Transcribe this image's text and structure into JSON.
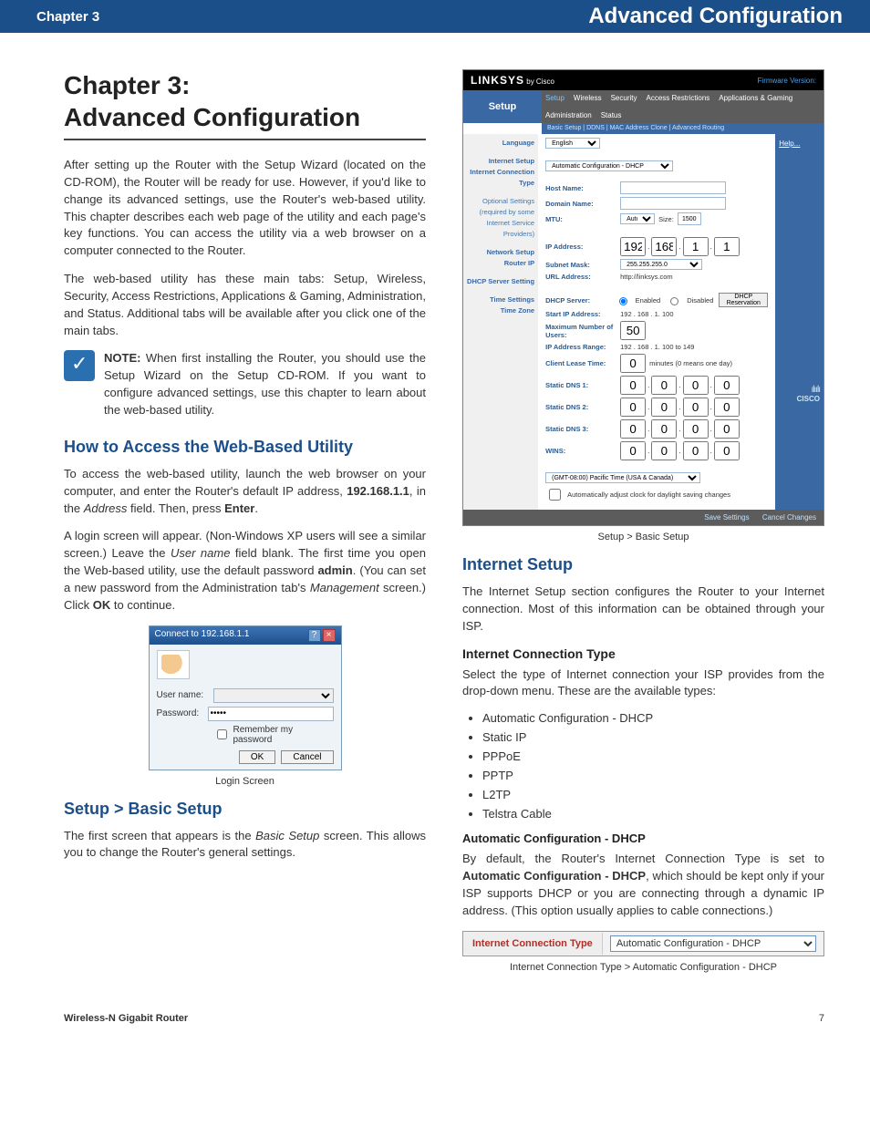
{
  "header": {
    "chapter": "Chapter 3",
    "section": "Advanced Configuration"
  },
  "page": {
    "title_line1": "Chapter 3:",
    "title_line2": "Advanced Configuration",
    "intro_p1": "After setting up the Router with the Setup Wizard (located on the CD-ROM), the Router will be ready for use. However, if you'd like to change its advanced settings, use the Router's web-based utility. This chapter describes each web page of the utility and each page's key functions. You can access the utility via a web browser on a computer connected to the Router.",
    "intro_p2": "The web-based utility has these main tabs: Setup, Wireless, Security, Access Restrictions, Applications & Gaming, Administration, and Status. Additional tabs will be available after you click one of the main tabs.",
    "note_label": "NOTE:",
    "note_text": " When first installing the Router, you should use the Setup Wizard on the Setup CD-ROM. If you want to configure advanced settings, use this chapter to learn about the web-based utility.",
    "h2_access": "How to Access the Web-Based Utility",
    "access_p1a": "To access the web-based utility, launch the web browser on your computer, and enter the Router's default IP address, ",
    "access_ip": "192.168.1.1",
    "access_p1b": ", in the ",
    "access_addrfield": "Address",
    "access_p1c": " field. Then, press ",
    "access_enter": "Enter",
    "access_p1d": ".",
    "access_p2a": "A login screen will appear. (Non-Windows XP users will see a similar screen.) Leave the ",
    "access_username_i": "User name",
    "access_p2b": " field blank. The first time you open the Web-based utility, use the default password ",
    "access_admin": "admin",
    "access_p2c": ". (You can set a new password from the Administration tab's ",
    "access_mgmt_i": "Management",
    "access_p2d": " screen.) Click ",
    "access_ok": "OK",
    "access_p2e": " to continue.",
    "login": {
      "title": "Connect to 192.168.1.1",
      "user_label": "User name:",
      "pass_label": "Password:",
      "pass_value": "•••••",
      "remember": "Remember my password",
      "ok": "OK",
      "cancel": "Cancel",
      "caption": "Login Screen"
    },
    "h2_basic": "Setup > Basic Setup",
    "basic_p1a": "The first screen that appears is the ",
    "basic_p1_i": "Basic Setup",
    "basic_p1b": " screen. This allows you to change the Router's general settings.",
    "router_caption": "Setup > Basic Setup",
    "h2_internet": "Internet Setup",
    "internet_p1": "The Internet Setup section configures the Router to your Internet connection. Most of this information can be obtained through your ISP.",
    "h3_ict": "Internet Connection Type",
    "ict_p1": "Select the type of Internet connection your ISP provides from the drop-down menu. These are the available types:",
    "ict_list": [
      "Automatic Configuration - DHCP",
      "Static IP",
      "PPPoE",
      "PPTP",
      "L2TP",
      "Telstra Cable"
    ],
    "h4_auto": "Automatic Configuration - DHCP",
    "auto_p1a": "By default, the Router's Internet Connection Type is set to ",
    "auto_bold": "Automatic Configuration - DHCP",
    "auto_p1b": ", which should be kept only if your ISP supports DHCP or you are connecting through a dynamic IP address. (This option usually applies to cable connections.)",
    "ict_box_label": "Internet Connection Type",
    "ict_box_value": "Automatic Configuration - DHCP",
    "ict_caption": "Internet Connection Type > Automatic Configuration - DHCP"
  },
  "router": {
    "brand": "LINKSYS",
    "bycisco": " by Cisco",
    "fw": "Firmware Version:",
    "setup": "Setup",
    "tabs": [
      "Setup",
      "Wireless",
      "Security",
      "Access Restrictions",
      "Applications & Gaming",
      "Administration",
      "Status"
    ],
    "subtabs": "Basic Setup   |   DDNS   |   MAC Address Clone   |   Advanced Routing",
    "side": {
      "language": "Language",
      "internet_setup": "Internet Setup",
      "ict": "Internet Connection Type",
      "optional": "Optional Settings (required by some Internet Service Providers)",
      "network": "Network Setup",
      "routerip": "Router IP",
      "dhcp": "DHCP Server Setting",
      "time": "Time Settings",
      "timezone": "Time Zone"
    },
    "fields": {
      "language_val": "English",
      "ict_val": "Automatic Configuration - DHCP",
      "hostname": "Host Name:",
      "domainname": "Domain Name:",
      "mtu": "MTU:",
      "mtu_mode": "Auto",
      "mtu_size": "Size:",
      "mtu_size_val": "1500",
      "ipaddress": "IP Address:",
      "ip_o1": "192",
      "ip_o2": "168",
      "ip_o3": "1",
      "ip_o4": "1",
      "subnet": "Subnet Mask:",
      "subnet_val": "255.255.255.0",
      "url": "URL Address:",
      "url_val": "http://linksys.com",
      "dhcp_server": "DHCP Server:",
      "enabled": "Enabled",
      "disabled": "Disabled",
      "dhcp_res": "DHCP Reservation",
      "start_ip": "Start IP Address:",
      "start_ip_val": "192 . 168 . 1. 100",
      "max_users": "Maximum Number of Users:",
      "max_users_val": "50",
      "ip_range": "IP Address Range:",
      "ip_range_val": "192 . 168 . 1. 100 to 149",
      "lease": "Client Lease Time:",
      "lease_val": "0",
      "lease_unit": "minutes (0 means one day)",
      "dns1": "Static DNS 1:",
      "dns2": "Static DNS 2:",
      "dns3": "Static DNS 3:",
      "wins": "WINS:",
      "z": "0",
      "tz_val": "(GMT-08:00) Pacific Time (USA & Canada)",
      "auto_adjust": "Automatically adjust clock for daylight saving changes"
    },
    "right_help": "Help...",
    "foot_save": "Save Settings",
    "foot_cancel": "Cancel Changes",
    "cisco": "CISCO"
  },
  "footer": {
    "product": "Wireless-N Gigabit Router",
    "pageno": "7"
  }
}
